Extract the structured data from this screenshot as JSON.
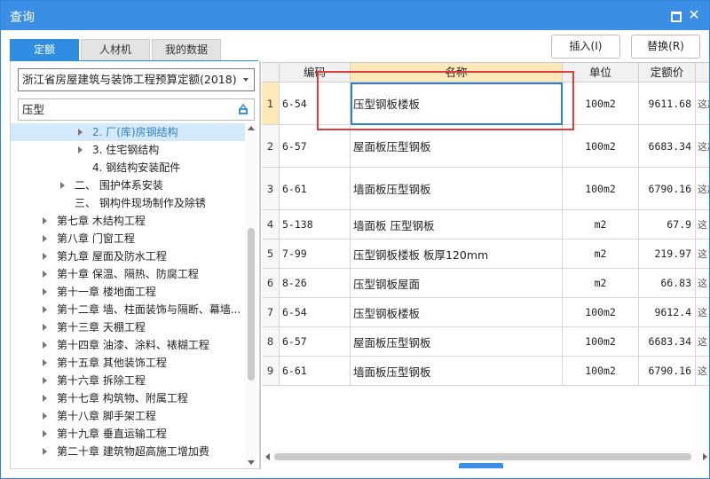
{
  "window": {
    "title": "查询"
  },
  "tabs": [
    {
      "label": "定额"
    },
    {
      "label": "人材机"
    },
    {
      "label": "我的数据"
    }
  ],
  "buttons": {
    "insert": "插入(I)",
    "replace": "替换(R)"
  },
  "library": {
    "selected": "浙江省房屋建筑与装饰工程预算定额(2018)"
  },
  "search": {
    "value": "压型"
  },
  "tree": [
    {
      "label": "2. 厂(库)房钢结构",
      "expander": true,
      "selected": true
    },
    {
      "label": "3. 住宅钢结构",
      "expander": true
    },
    {
      "label": "4. 钢结构安装配件",
      "expander": false
    },
    {
      "label": "二、 围护体系安装",
      "expander": true
    },
    {
      "label": "三、 钢构件现场制作及除锈",
      "expander": false
    },
    {
      "label": "第七章 木结构工程",
      "expander": true
    },
    {
      "label": "第八章 门窗工程",
      "expander": true
    },
    {
      "label": "第九章 屋面及防水工程",
      "expander": true
    },
    {
      "label": "第十章 保温、隔热、防腐工程",
      "expander": true
    },
    {
      "label": "第十一章 楼地面工程",
      "expander": true
    },
    {
      "label": "第十二章 墙、柱面装饰与隔断、幕墙...",
      "expander": true
    },
    {
      "label": "第十三章 天棚工程",
      "expander": true
    },
    {
      "label": "第十四章 油漆、涂料、裱糊工程",
      "expander": true
    },
    {
      "label": "第十五章 其他装饰工程",
      "expander": true
    },
    {
      "label": "第十六章 拆除工程",
      "expander": true
    },
    {
      "label": "第十七章 构筑物、附属工程",
      "expander": true
    },
    {
      "label": "第十八章 脚手架工程",
      "expander": true
    },
    {
      "label": "第十九章 垂直运输工程",
      "expander": true
    },
    {
      "label": "第二十章 建筑物超高施工增加费",
      "expander": true
    }
  ],
  "table": {
    "headers": {
      "code": "编码",
      "name": "名称",
      "unit": "单位",
      "price": "定额价"
    },
    "rows": [
      {
        "n": "1",
        "code": "6-54",
        "name": "压型钢板楼板",
        "unit": "100m2",
        "price": "9611.68",
        "extra": "这施"
      },
      {
        "n": "2",
        "code": "6-57",
        "name": "屋面板压型钢板",
        "unit": "100m2",
        "price": "6683.34",
        "extra": "这施"
      },
      {
        "n": "3",
        "code": "6-61",
        "name": "墙面板压型钢板",
        "unit": "100m2",
        "price": "6790.16",
        "extra": "这施"
      },
      {
        "n": "4",
        "code": "5-138",
        "name": "墙面板 压型钢板",
        "unit": "m2",
        "price": "67.9",
        "extra": "这"
      },
      {
        "n": "5",
        "code": "7-99",
        "name": "压型钢板楼板 板厚120mm",
        "unit": "m2",
        "price": "219.97",
        "extra": "这"
      },
      {
        "n": "6",
        "code": "8-26",
        "name": "压型钢板屋面",
        "unit": "m2",
        "price": "66.83",
        "extra": "这"
      },
      {
        "n": "7",
        "code": "6-54",
        "name": "压型钢板楼板",
        "unit": "100m2",
        "price": "9612.4",
        "extra": "这"
      },
      {
        "n": "8",
        "code": "6-57",
        "name": "屋面板压型钢板",
        "unit": "100m2",
        "price": "6683.34",
        "extra": "这"
      },
      {
        "n": "9",
        "code": "6-61",
        "name": "墙面板压型钢板",
        "unit": "100m2",
        "price": "6790.16",
        "extra": "这"
      }
    ]
  },
  "colors": {
    "accent": "#3a8ee6",
    "highlight": "#fde9b8",
    "annotation": "#e23b3b"
  }
}
